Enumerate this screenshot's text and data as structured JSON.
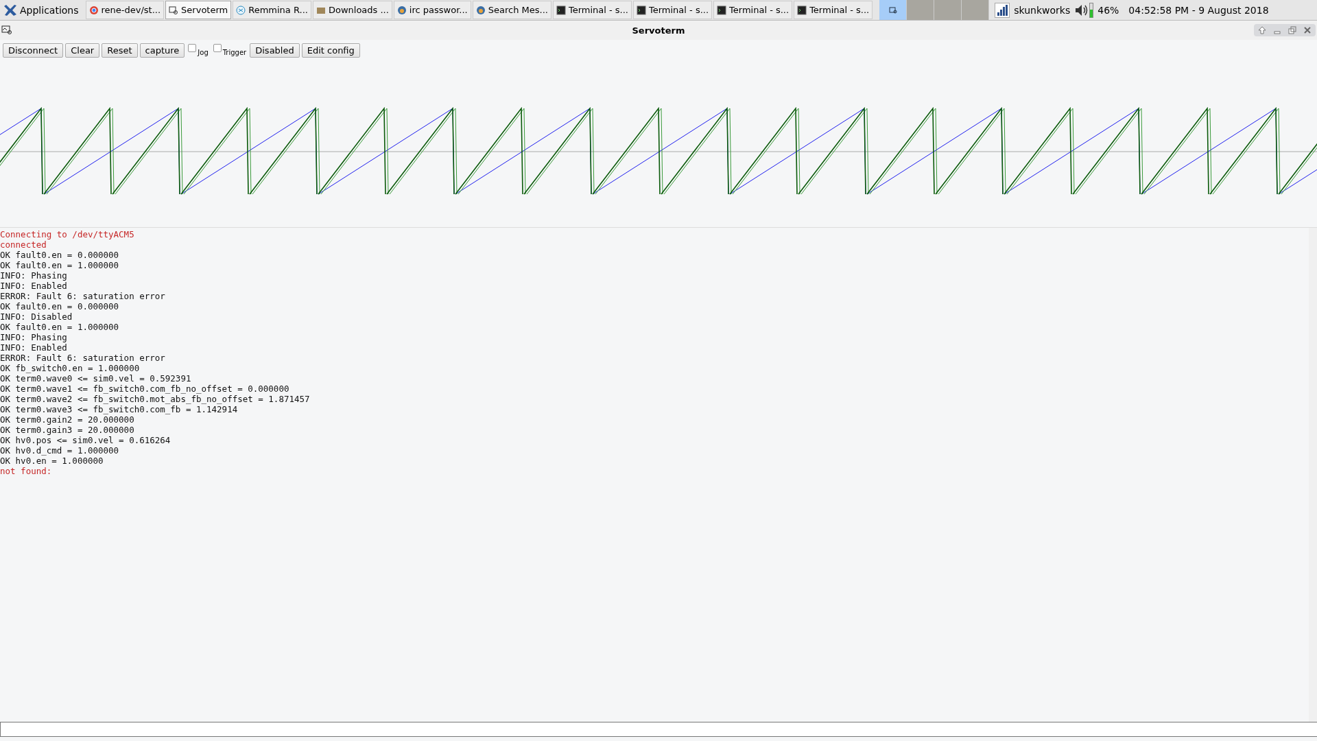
{
  "taskbar": {
    "menu_label": "Applications",
    "tasks": [
      {
        "label": "rene-dev/st...",
        "kind": "browser",
        "selected": false
      },
      {
        "label": "Servoterm",
        "kind": "scope",
        "selected": true
      },
      {
        "label": "Remmina R...",
        "kind": "remote",
        "selected": false
      },
      {
        "label": "Downloads ...",
        "kind": "folder",
        "selected": false
      },
      {
        "label": "irc passwor...",
        "kind": "mail",
        "selected": false
      },
      {
        "label": "Search Mes...",
        "kind": "mail",
        "selected": false
      },
      {
        "label": "Terminal - s...",
        "kind": "terminal",
        "selected": false
      },
      {
        "label": "Terminal - s...",
        "kind": "terminal",
        "selected": false
      },
      {
        "label": "Terminal - s...",
        "kind": "terminal",
        "selected": false
      },
      {
        "label": "Terminal - s...",
        "kind": "terminal",
        "selected": false
      }
    ],
    "desktops": [
      {
        "selected": true
      },
      {
        "selected": false
      },
      {
        "selected": false
      },
      {
        "selected": false
      }
    ],
    "network_name": "skunkworks",
    "battery": "46%",
    "clock": "04:52:58 PM - 9 August 2018"
  },
  "window": {
    "title": "Servoterm"
  },
  "toolbar": [
    {
      "kind": "button",
      "label": "Disconnect"
    },
    {
      "kind": "button",
      "label": "Clear"
    },
    {
      "kind": "button",
      "label": "Reset"
    },
    {
      "kind": "button",
      "label": "capture"
    },
    {
      "kind": "checkbox",
      "label": "Jog",
      "checked": false
    },
    {
      "kind": "checkbox",
      "label": "Trigger",
      "checked": false
    },
    {
      "kind": "button",
      "label": "Disabled"
    },
    {
      "kind": "button",
      "label": "Edit config"
    }
  ],
  "log": [
    {
      "kind": "status",
      "text": "Connecting to /dev/ttyACM5"
    },
    {
      "kind": "status",
      "text": "connected"
    },
    {
      "kind": "reply",
      "text": "OK fault0.en = 0.000000"
    },
    {
      "kind": "reply",
      "text": "OK fault0.en = 1.000000"
    },
    {
      "kind": "reply",
      "text": "INFO: Phasing"
    },
    {
      "kind": "reply",
      "text": "INFO: Enabled"
    },
    {
      "kind": "reply",
      "text": "ERROR: Fault 6: saturation error"
    },
    {
      "kind": "reply",
      "text": "OK fault0.en = 0.000000"
    },
    {
      "kind": "reply",
      "text": "INFO: Disabled"
    },
    {
      "kind": "reply",
      "text": "OK fault0.en = 1.000000"
    },
    {
      "kind": "reply",
      "text": "INFO: Phasing"
    },
    {
      "kind": "reply",
      "text": "INFO: Enabled"
    },
    {
      "kind": "reply",
      "text": "ERROR: Fault 6: saturation error"
    },
    {
      "kind": "reply",
      "text": "OK fb_switch0.en = 1.000000"
    },
    {
      "kind": "reply",
      "text": "OK term0.wave0 <= sim0.vel = 0.592391"
    },
    {
      "kind": "reply",
      "text": "OK term0.wave1 <= fb_switch0.com_fb_no_offset = 0.000000"
    },
    {
      "kind": "reply",
      "text": "OK term0.wave2 <= fb_switch0.mot_abs_fb_no_offset = 1.871457"
    },
    {
      "kind": "reply",
      "text": "OK term0.wave3 <= fb_switch0.com_fb = 1.142914"
    },
    {
      "kind": "reply",
      "text": "OK term0.gain2 = 20.000000"
    },
    {
      "kind": "reply",
      "text": "OK term0.gain3 = 20.000000"
    },
    {
      "kind": "reply",
      "text": "OK hv0.pos <= sim0.vel = 0.616264"
    },
    {
      "kind": "reply",
      "text": "OK hv0.d_cmd = 1.000000"
    },
    {
      "kind": "reply",
      "text": "OK hv0.en = 1.000000"
    },
    {
      "kind": "status",
      "text": "not found:"
    }
  ]
}
